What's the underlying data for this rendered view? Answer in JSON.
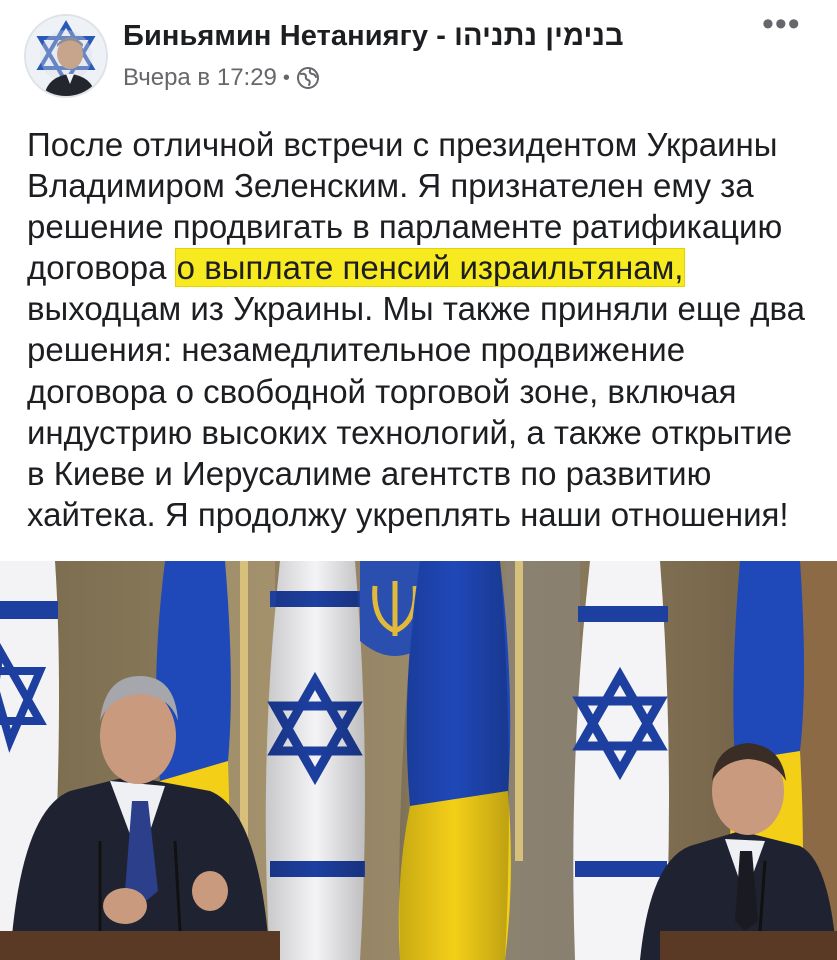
{
  "post": {
    "author": "Биньямин Нетаниягу - בנימין נתניהו",
    "timestamp": "Вчера в 17:29",
    "separator": "•",
    "privacy_icon": "globe-icon",
    "more_label": "•••",
    "text_before": "После отличной встречи с президентом Украины Владимиром Зеленским. Я признателен ему за решение продвигать в парламенте ратификацию договора",
    "text_highlight": "о выплате пенсий израильтянам,",
    "text_after": "выходцам из Украины. Мы также приняли еще два решения: незамедлительное продвижение договора о свободной торговой зоне, включая индустрию высоких технологий, а также открытие в Киеве и Иерусалиме агентств по развитию хайтека. Я продолжу укреплять наши отношения!",
    "highlight_color": "#f7ea21"
  },
  "photo": {
    "description_icon": "press-conference-photo",
    "flag_colors": {
      "israel_blue": "#1d3fa0",
      "ukraine_blue": "#1f48b8",
      "ukraine_yellow": "#f4cf18"
    }
  }
}
